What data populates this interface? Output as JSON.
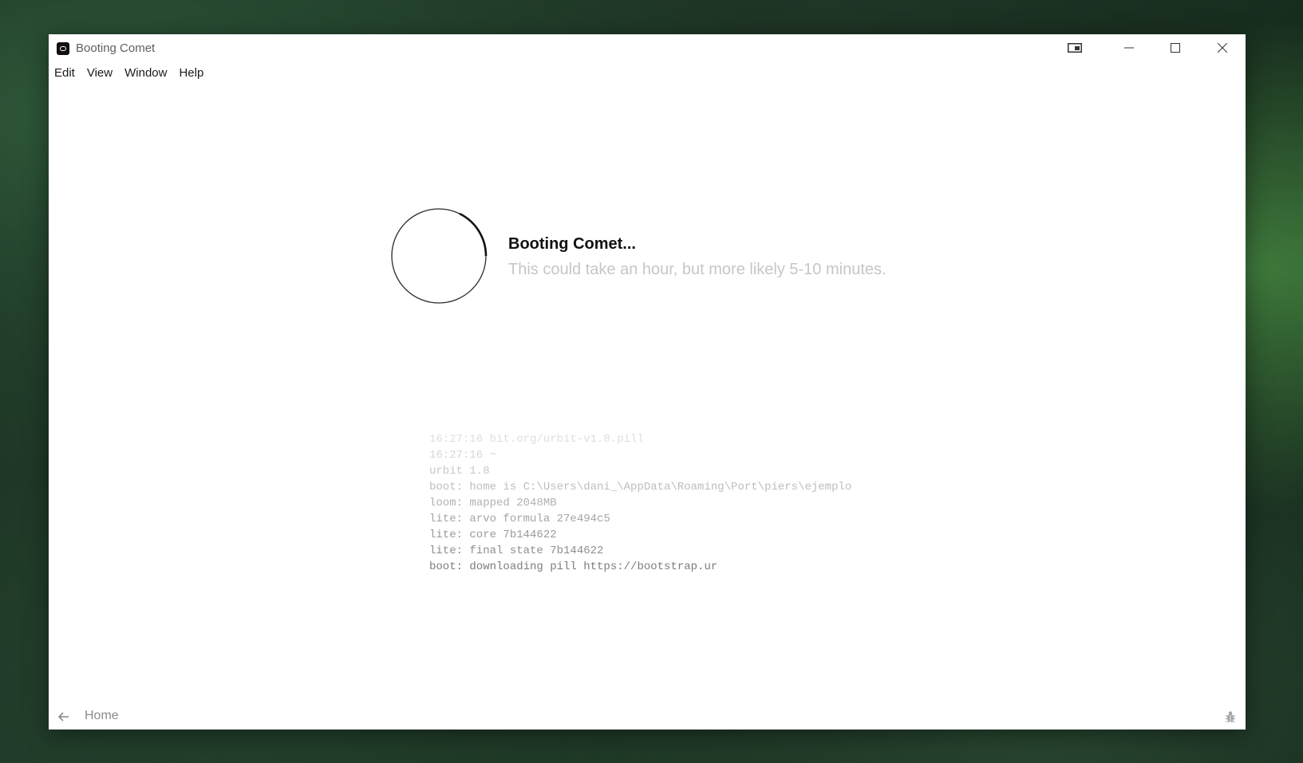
{
  "window": {
    "title": "Booting Comet",
    "icons": {
      "app": "comet-app-icon",
      "extra": "pip-icon",
      "minimize": "minimize-icon",
      "maximize": "maximize-icon",
      "close": "close-icon"
    }
  },
  "menu": {
    "items": [
      {
        "label": "Edit"
      },
      {
        "label": "View"
      },
      {
        "label": "Window"
      },
      {
        "label": "Help"
      }
    ]
  },
  "boot": {
    "title": "Booting Comet...",
    "subtitle": "This could take an hour, but more likely 5-10 minutes."
  },
  "log": {
    "lines": [
      "16:27:16 bit.org/urbit-v1.8.pill",
      "16:27:16 ~",
      "urbit 1.8",
      "boot: home is C:\\Users\\dani_\\AppData\\Roaming\\Port\\piers\\ejemplo",
      "loom: mapped 2048MB",
      "lite: arvo formula 27e494c5",
      "lite: core 7b144622",
      "lite: final state 7b144622",
      "boot: downloading pill https://bootstrap.ur"
    ],
    "colors": [
      "#dedede",
      "#d6d6d6",
      "#c8c8c8",
      "#bdbdbd",
      "#b1b1b1",
      "#a5a5a5",
      "#9a9a9a",
      "#8e8e8e",
      "#7d7d7d"
    ]
  },
  "statusbar": {
    "home_label": "Home",
    "back_icon": "arrow-left-icon",
    "bug_icon": "bug-icon"
  }
}
